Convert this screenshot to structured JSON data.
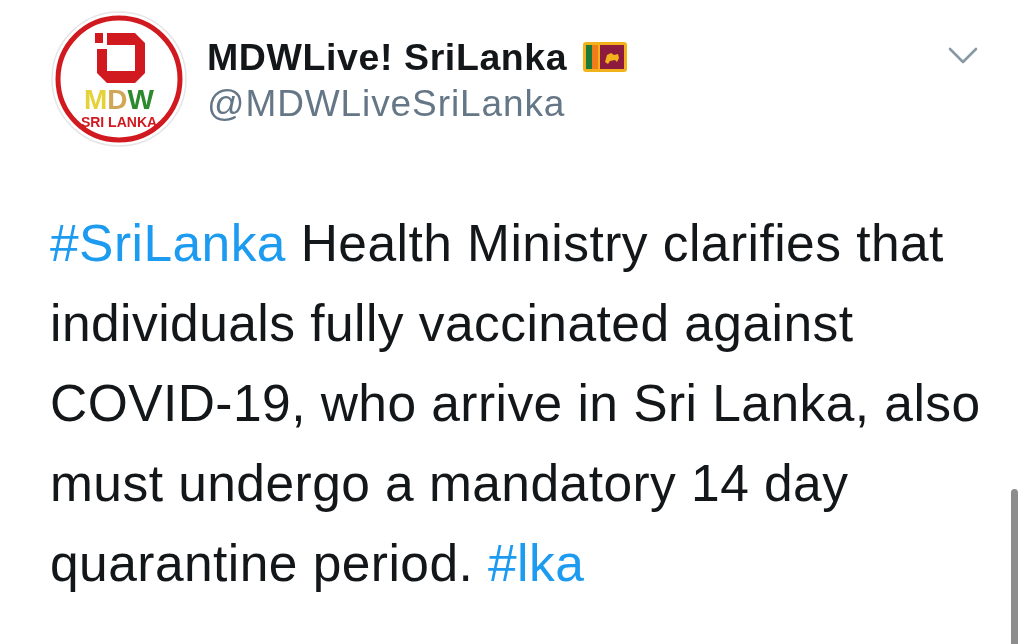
{
  "account": {
    "avatar": {
      "logo_mark": "MDW",
      "logo_text": "SRI LANKA"
    },
    "display_name": "MDWLive! SriLanka",
    "handle": "@MDWLiveSriLanka"
  },
  "tweet": {
    "segments": [
      {
        "kind": "hashtag",
        "text": "#SriLanka"
      },
      {
        "kind": "text",
        "text": " Health Ministry clarifies that individuals fully vaccinated against COVID-19, who arrive in Sri Lanka, also must undergo a mandatory 14 day quarantine period. "
      },
      {
        "kind": "hashtag",
        "text": "#lka"
      }
    ]
  }
}
